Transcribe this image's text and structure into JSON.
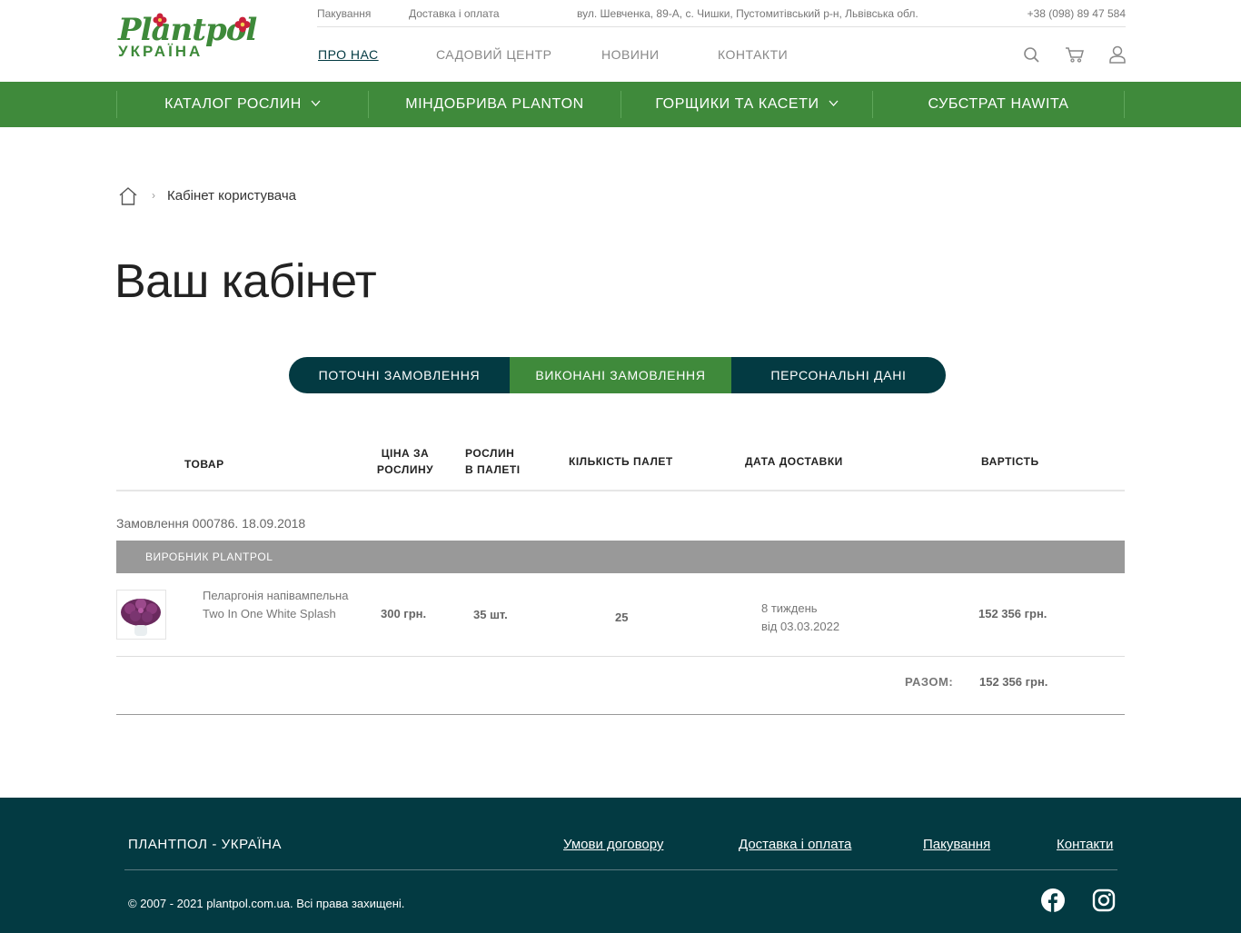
{
  "header": {
    "logo_top": "Plantpol",
    "logo_bottom": "УКРАЇНА",
    "topbar": {
      "packaging": "Пакування",
      "delivery": "Доставка і оплата",
      "address": "вул. Шевченка, 89-А, с. Чишки, Пустомитівський р-н, Львівська обл.",
      "phone": "+38 (098) 89 47 584"
    },
    "nav": [
      "ПРО НАС",
      "САДОВИЙ ЦЕНТР",
      "НОВИНИ",
      "КОНТАКТИ"
    ],
    "icons": [
      "search-icon",
      "cart-icon",
      "user-icon"
    ]
  },
  "menu": [
    "КАТАЛОГ РОСЛИН",
    "МІНДОБРИВА PLANTON",
    "ГОРЩИКИ ТА КАСЕТИ",
    "СУБСТРАТ HAWITA"
  ],
  "breadcrumb": {
    "current": "Кабінет користувача"
  },
  "page_title": "Ваш кабінет",
  "tabs": [
    "ПОТОЧНІ ЗАМОВЛЕННЯ",
    "ВИКОНАНІ ЗАМОВЛЕННЯ",
    "ПЕРСОНАЛЬНІ ДАНІ"
  ],
  "active_tab": "ВИКОНАНІ ЗАМОВЛЕННЯ",
  "table": {
    "headers": {
      "product": "ТОВАР",
      "price_1": "ЦІНА ЗА",
      "price_2": "РОСЛИНУ",
      "per_pallet_1": "РОСЛИН",
      "per_pallet_2": "В ПАЛЕТІ",
      "pallets": "КІЛЬКІСТЬ ПАЛЕТ",
      "delivery": "ДАТА ДОСТАВКИ",
      "cost": "ВАРТІСТЬ"
    },
    "order_title": "Замовлення 000786. 18.09.2018",
    "maker": "ВИРОБНИК PLANTPOL",
    "row": {
      "name_1": "Пеларгонія напівампельна",
      "name_2": "Two In One White Splash",
      "price": "300 грн.",
      "per_pallet": "35 шт.",
      "pallets": "25",
      "delivery_1": "8 тиждень",
      "delivery_2": "від 03.03.2022",
      "cost": "152 356 грн."
    },
    "total_label": "РАЗОМ:",
    "total_value": "152 356 грн."
  },
  "footer": {
    "brand": "ПЛАНТПОЛ - УКРАЇНА",
    "links": [
      "Умови договору",
      "Доставка і оплата",
      "Пакування",
      "Контакти"
    ],
    "copyright": "© 2007 - 2021 plantpol.com.ua. Всі права захищені.",
    "social": [
      "facebook-icon",
      "instagram-icon"
    ]
  },
  "colors": {
    "green": "#3f8a3b",
    "dark_teal": "#033a42",
    "grey_bar": "#999999"
  }
}
